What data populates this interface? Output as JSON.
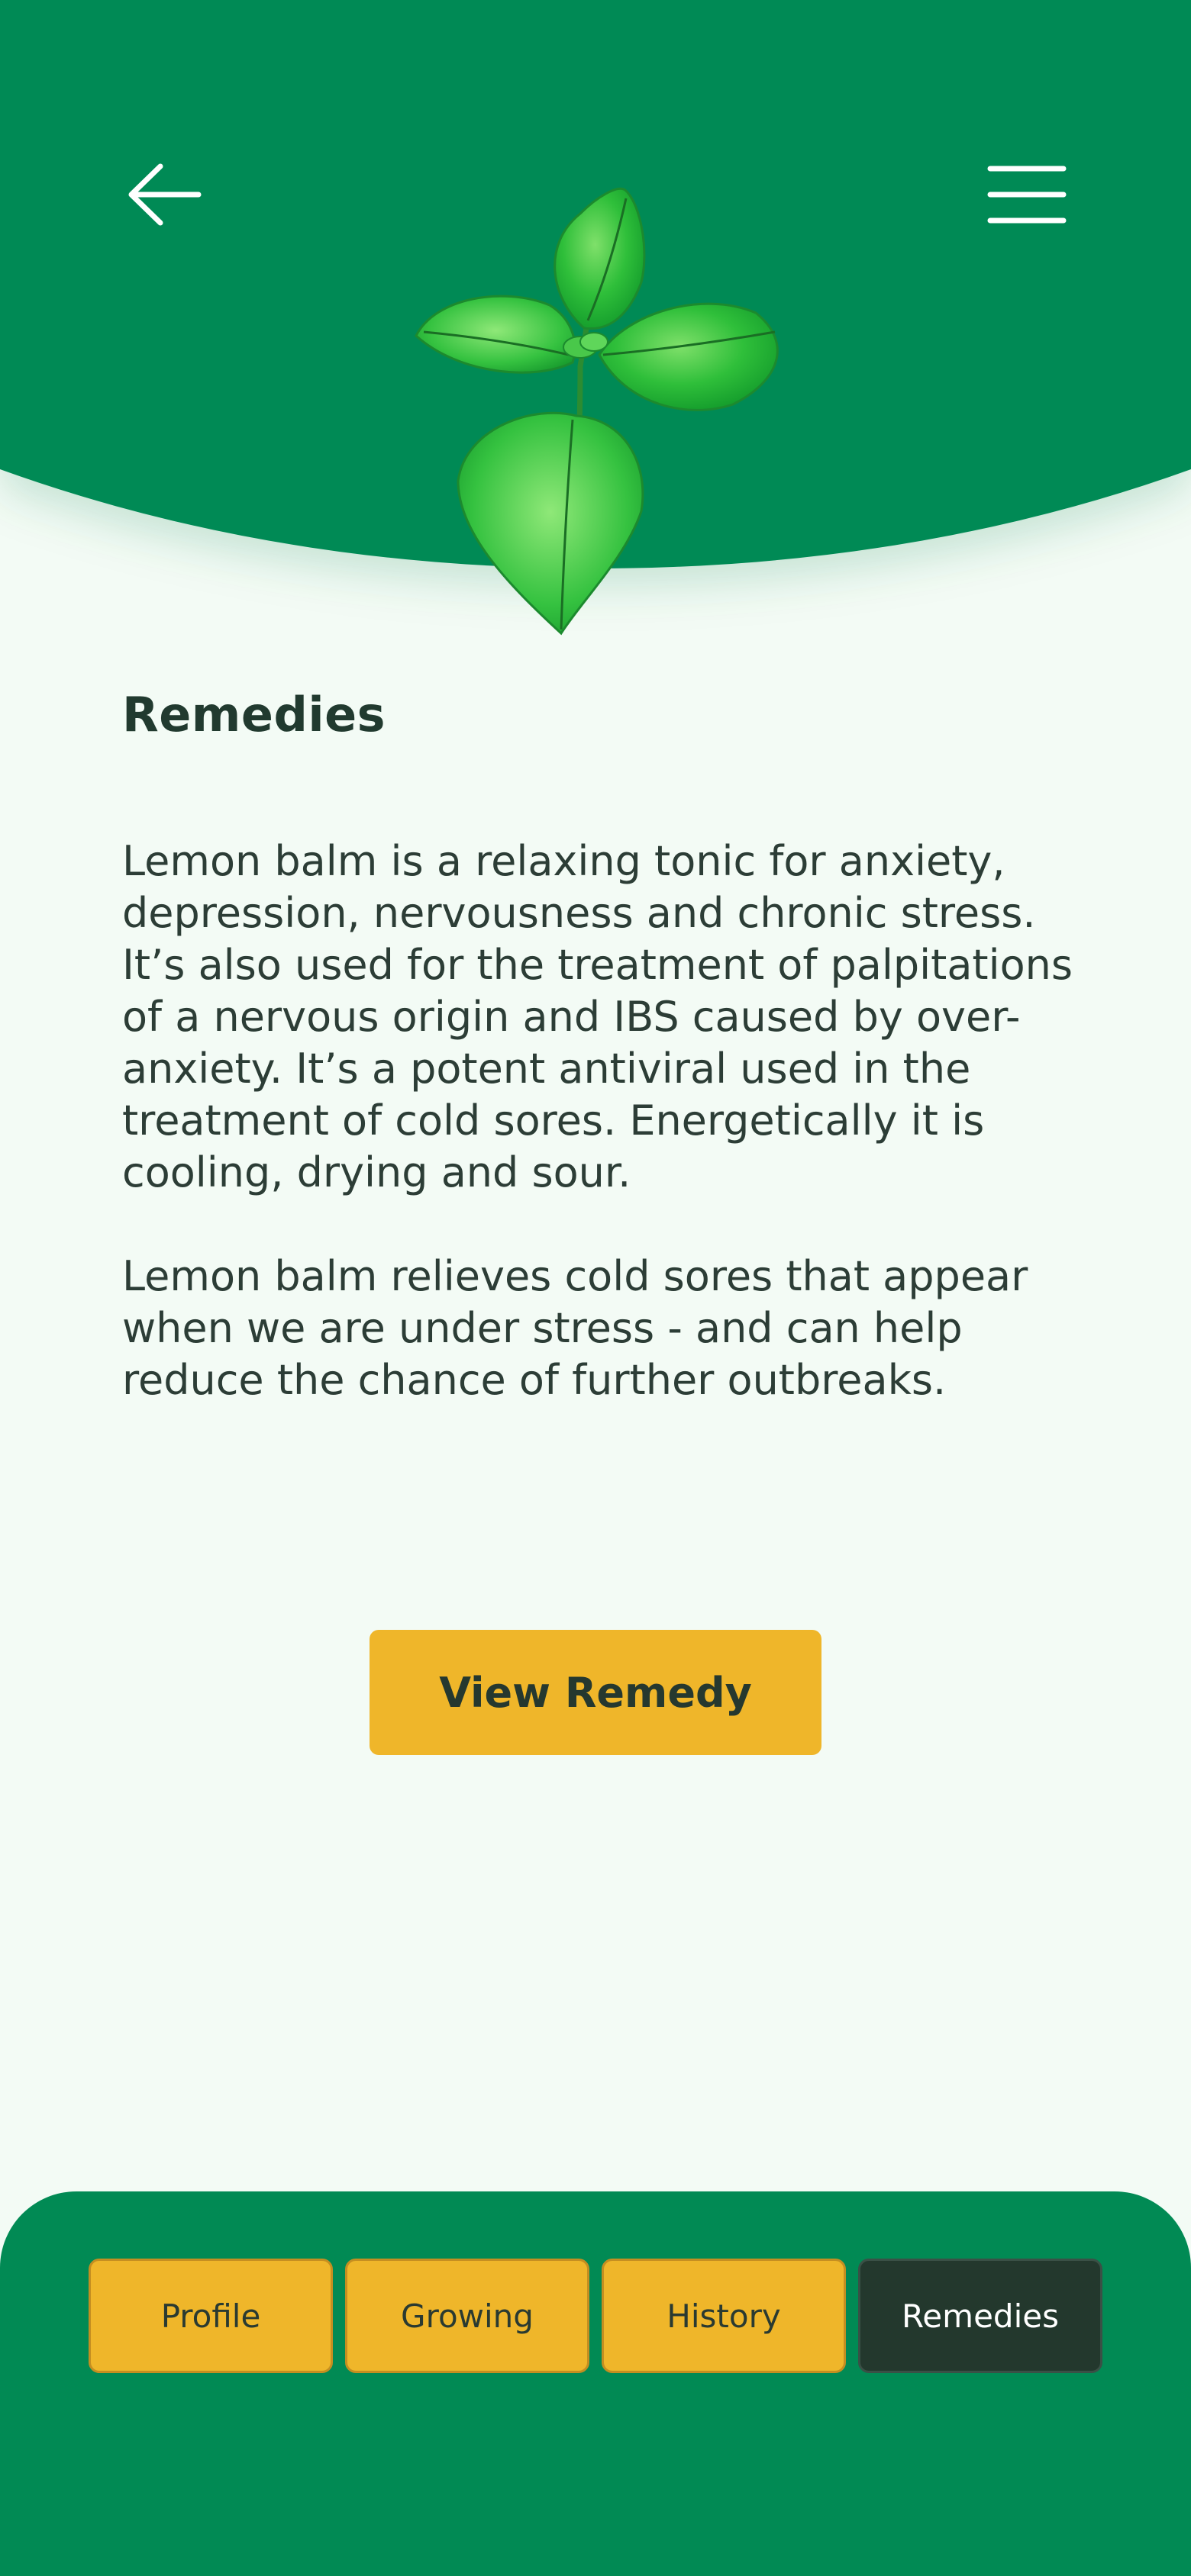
{
  "header": {
    "back_icon": "arrow-left-icon",
    "menu_icon": "hamburger-menu-icon",
    "image": "lemon-balm-plant-illustration"
  },
  "section": {
    "title": "Remedies",
    "paragraphs": [
      "Lemon balm is a relaxing tonic for anxiety, depression, nervousness and chronic stress.  It’s also used for the treatment of palpitations of a nervous origin and IBS caused by over-anxiety. It’s a potent antiviral used in the treatment of cold sores. Energetically it is cooling, drying and sour.",
      "Lemon balm relieves cold sores that appear when we are under stress - and can help reduce the chance of further outbreaks."
    ]
  },
  "actions": {
    "view_remedy_label": "View Remedy"
  },
  "nav": {
    "tabs": [
      {
        "label": "Profile"
      },
      {
        "label": "Growing"
      },
      {
        "label": "History"
      },
      {
        "label": "Remedies"
      }
    ],
    "active": "Remedies"
  },
  "colors": {
    "brand_green": "#018a54",
    "accent_yellow": "#efb62a",
    "dark": "#23382d",
    "background": "#f3fbf5"
  }
}
